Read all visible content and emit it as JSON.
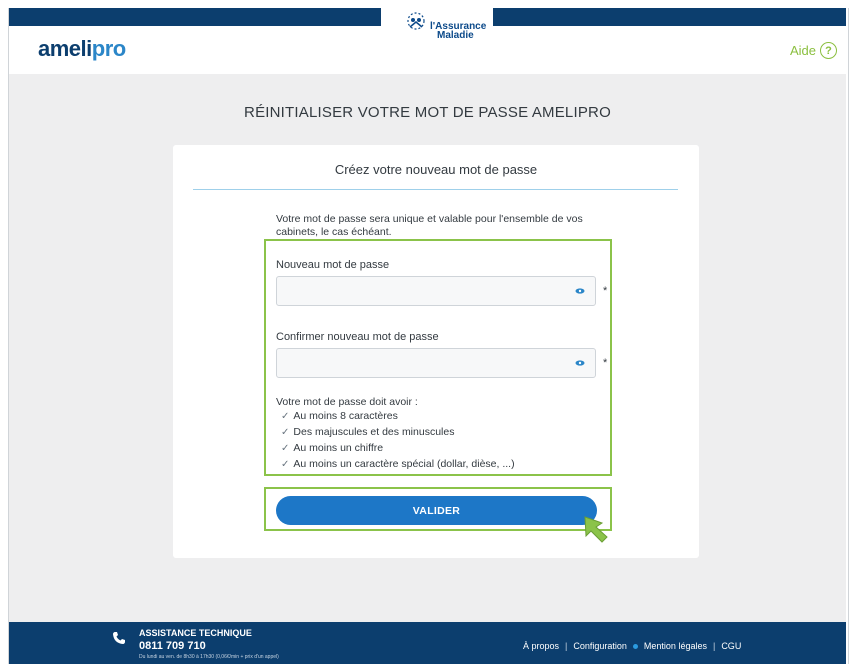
{
  "header": {
    "brand_part1": "ameli",
    "brand_part2": "pro",
    "partner_logo_line1": "l'Assurance",
    "partner_logo_line2": "Maladie",
    "help_label": "Aide",
    "help_icon": "?"
  },
  "page": {
    "title": "RÉINITIALISER VOTRE MOT DE PASSE AMELIPRO"
  },
  "card": {
    "title": "Créez votre nouveau mot de passe",
    "intro": "Votre mot de passe sera unique et valable pour l'ensemble de vos cabinets, le cas échéant.",
    "new_password_label": "Nouveau mot de passe",
    "new_password_value": "",
    "confirm_password_label": "Confirmer nouveau mot de passe",
    "confirm_password_value": "",
    "required_marker": "*",
    "rules_title": "Votre mot de passe doit avoir :",
    "rules": [
      "Au moins 8 caractères",
      "Des majuscules et des minuscules",
      "Au moins un chiffre",
      "Au moins un caractère spécial (dollar, dièse, ...)"
    ],
    "submit_label": "VALIDER"
  },
  "footer": {
    "assist_title": "ASSISTANCE TECHNIQUE",
    "phone": "0811 709 710",
    "hours": "Du lundi au ven. de 8h30 à 17h30 (0,06€/min + prix d'un appel)",
    "links": [
      "À propos",
      "Configuration",
      "Mention légales",
      "CGU"
    ]
  },
  "colors": {
    "navy": "#0c3e6e",
    "blue": "#1d77c7",
    "highlight_green": "#8bc34a",
    "help_green": "#8bbf3f"
  }
}
